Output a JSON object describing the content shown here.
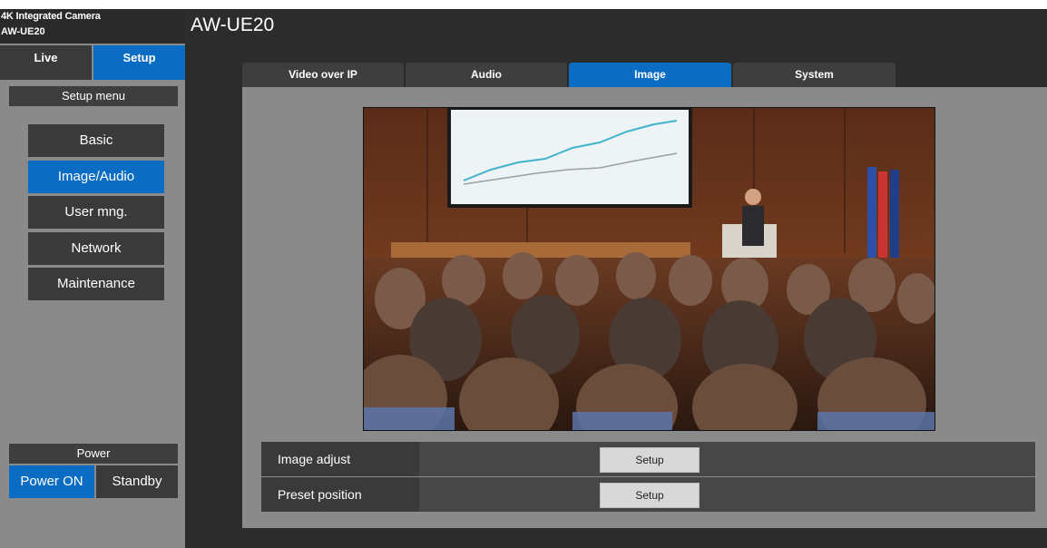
{
  "brand": {
    "line1": "4K Integrated Camera",
    "line2": "AW-UE20"
  },
  "mode_tabs": {
    "live": "Live",
    "setup": "Setup"
  },
  "setup_menu": {
    "title": "Setup menu",
    "items": [
      "Basic",
      "Image/Audio",
      "User mng.",
      "Network",
      "Maintenance"
    ],
    "active": "Image/Audio"
  },
  "power": {
    "title": "Power",
    "on_label": "Power ON",
    "standby_label": "Standby"
  },
  "page_title": "AW-UE20",
  "tabs": [
    "Video over IP",
    "Audio",
    "Image",
    "System"
  ],
  "active_tab": "Image",
  "settings_rows": [
    {
      "label": "Image adjust",
      "button": "Setup"
    },
    {
      "label": "Preset position",
      "button": "Setup"
    }
  ],
  "colors": {
    "accent": "#0b6cc4",
    "dark": "#3a3a3a",
    "panel": "#8a8a8a",
    "background": "#2c2c2c"
  }
}
